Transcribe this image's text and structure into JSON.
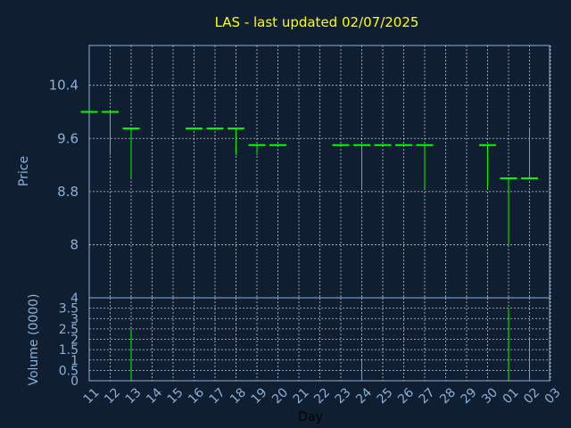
{
  "chart_data": {
    "type": "ohlc",
    "title": "LAS - last updated 02/07/2025",
    "xlabel": "Day",
    "price_panel": {
      "ylabel": "Price",
      "ylim": [
        7.2,
        11.0
      ],
      "yticks": [
        8,
        8.8,
        9.6,
        10.4
      ],
      "ytick_labels": [
        "8",
        "8.8",
        "9.6",
        "10.4"
      ]
    },
    "volume_panel": {
      "ylabel": "Volume (0000)",
      "ylim": [
        0,
        4
      ],
      "yticks": [
        0,
        0.5,
        1,
        1.5,
        2,
        2.5,
        3,
        3.5,
        4
      ],
      "ytick_labels": [
        "0",
        "0.5",
        "1",
        "1.5",
        "2",
        "2.5",
        "3",
        "3.5",
        "4"
      ]
    },
    "x_tick_labels": [
      "11",
      "12",
      "13",
      "14",
      "15",
      "16",
      "17",
      "18",
      "19",
      "20",
      "21",
      "22",
      "23",
      "24",
      "25",
      "26",
      "27",
      "28",
      "29",
      "30",
      "01",
      "02",
      "03"
    ],
    "candles": [
      {
        "x_index": 0,
        "open": 10.0,
        "high": 10.0,
        "low": 10.0,
        "close": 10.0,
        "volume": 0
      },
      {
        "x_index": 1,
        "open": 10.0,
        "high": 10.0,
        "low": 9.35,
        "close": 10.0,
        "volume": 0
      },
      {
        "x_index": 2,
        "open": 9.75,
        "high": 9.75,
        "low": 9.0,
        "close": 9.75,
        "volume": 2.5
      },
      {
        "x_index": 5,
        "open": 9.75,
        "high": 9.75,
        "low": 9.75,
        "close": 9.75,
        "volume": 0
      },
      {
        "x_index": 6,
        "open": 9.75,
        "high": 9.75,
        "low": 9.75,
        "close": 9.75,
        "volume": 0
      },
      {
        "x_index": 7,
        "open": 9.75,
        "high": 9.75,
        "low": 9.35,
        "close": 9.75,
        "volume": 0
      },
      {
        "x_index": 8,
        "open": 9.5,
        "high": 9.5,
        "low": 9.35,
        "close": 9.5,
        "volume": 0
      },
      {
        "x_index": 9,
        "open": 9.5,
        "high": 9.5,
        "low": 9.5,
        "close": 9.5,
        "volume": 0
      },
      {
        "x_index": 12,
        "open": 9.5,
        "high": 9.5,
        "low": 9.5,
        "close": 9.5,
        "volume": 0
      },
      {
        "x_index": 13,
        "open": 9.5,
        "high": 9.5,
        "low": 8.85,
        "close": 9.5,
        "volume": 1.0
      },
      {
        "x_index": 14,
        "open": 9.5,
        "high": 9.5,
        "low": 9.5,
        "close": 9.5,
        "volume": 0
      },
      {
        "x_index": 15,
        "open": 9.5,
        "high": 9.5,
        "low": 9.5,
        "close": 9.5,
        "volume": 0
      },
      {
        "x_index": 16,
        "open": 9.5,
        "high": 9.5,
        "low": 8.85,
        "close": 9.5,
        "volume": 0
      },
      {
        "x_index": 19,
        "open": 9.5,
        "high": 9.5,
        "low": 8.85,
        "close": 9.5,
        "volume": 0
      },
      {
        "x_index": 20,
        "open": 9.0,
        "high": 9.0,
        "low": 8.0,
        "close": 9.0,
        "volume": 3.5
      },
      {
        "x_index": 21,
        "open": 9.0,
        "high": 9.75,
        "low": 9.0,
        "close": 9.0,
        "volume": 2.0
      }
    ],
    "colors": {
      "background": "#0f1e30",
      "grid": "#ffffff",
      "frame": "#8cb0d8",
      "title": "#ffff00",
      "axis_text": "#8cb0d8",
      "candle": "#00ff00"
    },
    "grid": true
  }
}
